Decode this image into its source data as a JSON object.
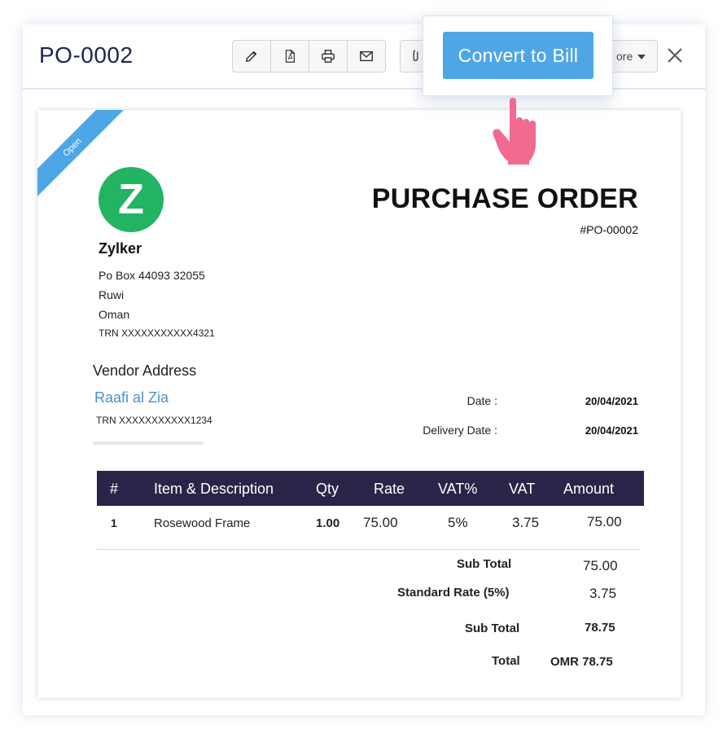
{
  "header": {
    "title": "PO-0002",
    "more_label": "ore",
    "toolbar_icons": [
      "pencil-icon",
      "pdf-icon",
      "printer-icon",
      "mail-icon",
      "paperclip-icon",
      "close-icon"
    ]
  },
  "popover": {
    "convert_label": "Convert to Bill"
  },
  "document": {
    "status_ribbon": "Open",
    "logo_letter": "Z",
    "company": {
      "name": "Zylker",
      "address_lines": [
        "Po Box 44093 32055",
        "Ruwi",
        "Oman"
      ],
      "trn": "TRN XXXXXXXXXXX4321"
    },
    "heading": "PURCHASE ORDER",
    "po_number": "#PO-00002",
    "vendor": {
      "label": "Vendor Address",
      "name": "Raafi al Zia",
      "trn": "TRN XXXXXXXXXXX1234"
    },
    "dates": {
      "date_label": "Date :",
      "date_value": "20/04/2021",
      "delivery_label": "Delivery Date :",
      "delivery_value": "20/04/2021"
    },
    "table": {
      "columns": [
        "#",
        "Item & Description",
        "Qty",
        "Rate",
        "VAT%",
        "VAT",
        "Amount"
      ],
      "rows": [
        {
          "num": "1",
          "item": "Rosewood Frame",
          "qty": "1.00",
          "rate": "75.00",
          "vat_pct": "5%",
          "vat": "3.75",
          "amount": "75.00"
        }
      ]
    },
    "totals": {
      "subtotal_label": "Sub Total",
      "subtotal_value": "75.00",
      "std_rate_label": "Standard Rate (5%)",
      "std_rate_value": "3.75",
      "subtotal2_label": "Sub Total",
      "subtotal2_value": "78.75",
      "total_label": "Total",
      "total_value": "OMR 78.75"
    }
  },
  "colors": {
    "accent_blue": "#4ea6e6",
    "table_header": "#2c2448",
    "logo_green": "#22b462",
    "cursor_pink": "#f06b8f",
    "title_navy": "#1f2450"
  }
}
